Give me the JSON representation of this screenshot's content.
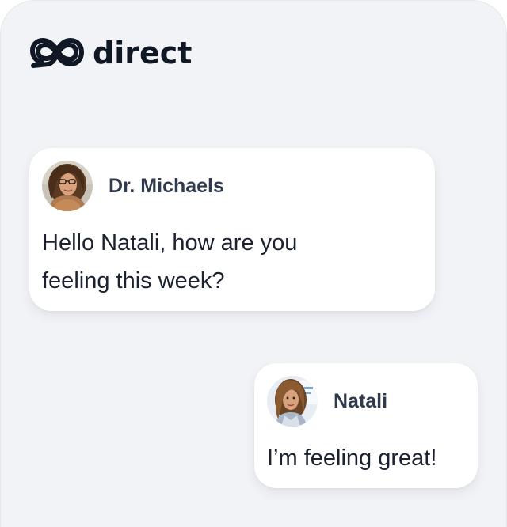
{
  "app": {
    "logo_text": "direct",
    "logo_icon": "infinity-chat-logo-icon"
  },
  "messages": [
    {
      "sender": "Dr. Michaels",
      "avatar": "doctor-avatar",
      "text": "Hello Natali, how are you feeling this week?"
    },
    {
      "sender": "Natali",
      "avatar": "patient-avatar",
      "text": "I’m feeling great!"
    }
  ],
  "colors": {
    "panel_background": "#f2f3f7",
    "bubble_background": "#ffffff",
    "sender_name": "#2f3a4c",
    "message_text": "#1b2130",
    "logo": "#101826"
  }
}
